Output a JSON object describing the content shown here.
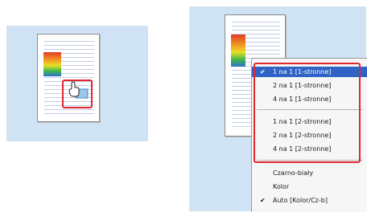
{
  "menu": {
    "items_group1": [
      "1 na 1 [1-stronne]",
      "2 na 1 [1-stronne]",
      "4 na 1 [1-stronne]"
    ],
    "items_group2": [
      "1 na 1 [2-stronne]",
      "2 na 1 [2-stronne]",
      "4 na 1 [2-stronne]"
    ],
    "items_color": [
      "Czarno-biały",
      "Kolor",
      "Auto [Kolor/Cz-b]"
    ],
    "selected_item": "1 na 1 [1-stronne]",
    "checked_color_item": "Auto [Kolor/Cz-b]",
    "check_glyph": "✔"
  },
  "colors": {
    "highlight": "#e0262f",
    "selection": "#2f63c6",
    "panel_bg": "#cfe3f4"
  },
  "icons": [
    "hand-pointer-icon",
    "page-thumbnail-icon"
  ]
}
